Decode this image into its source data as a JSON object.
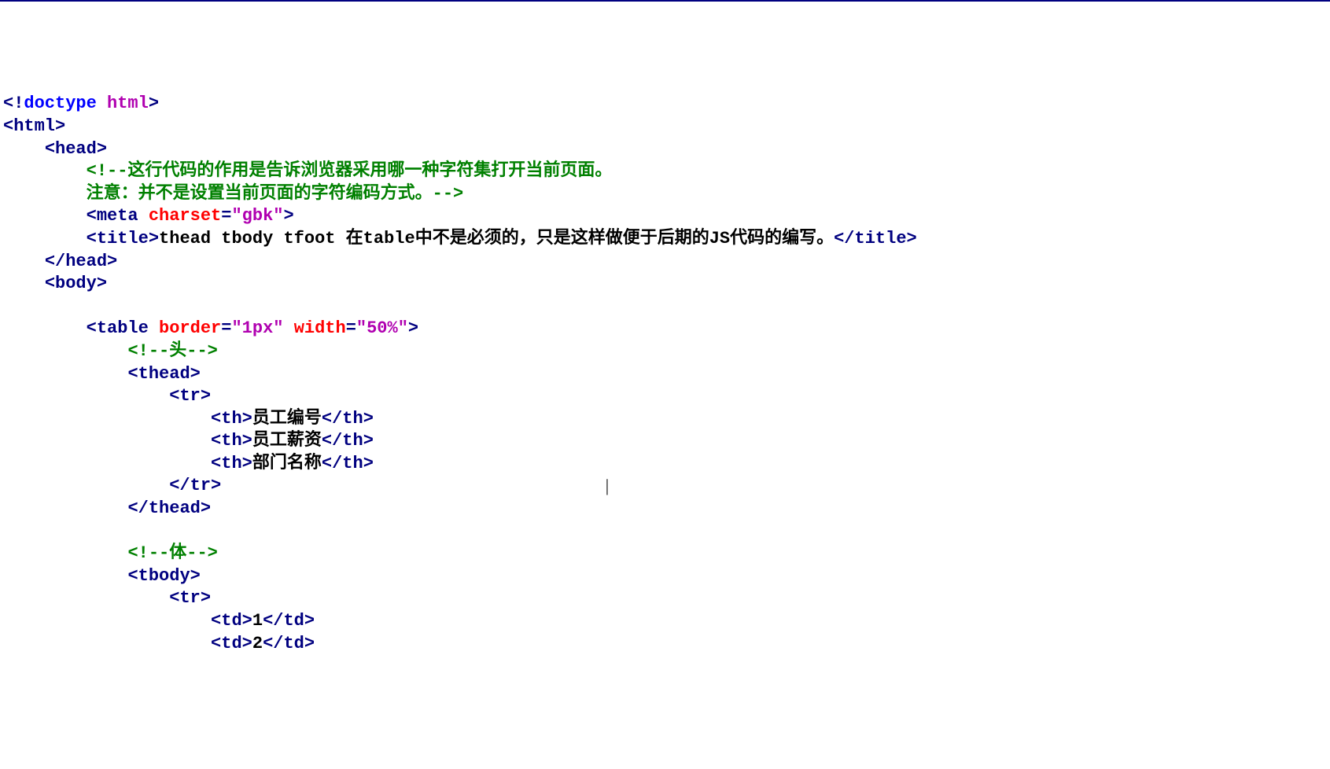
{
  "code": {
    "doctype_open": "<!",
    "doctype_kw": "doctype",
    "doctype_val": "html",
    "doctype_close": ">",
    "lt": "<",
    "lt_close": "</",
    "gt": ">",
    "sp": " ",
    "html_tag": "html",
    "head_tag": "head",
    "body_tag": "body",
    "meta_tag": "meta",
    "title_tag": "title",
    "table_tag": "table",
    "thead_tag": "thead",
    "tbody_tag": "tbody",
    "tr_tag": "tr",
    "th_tag": "th",
    "td_tag": "td",
    "charset_attr": "charset",
    "charset_val": "\"gbk\"",
    "border_attr": "border",
    "border_val": "\"1px\"",
    "width_attr": "width",
    "width_val": "\"50%\"",
    "eq": "=",
    "comment1": "<!--这行代码的作用是告诉浏览器采用哪一种字符集打开当前页面。",
    "comment1b": "注意：并不是设置当前页面的字符编码方式。-->",
    "title_text": "thead tbody tfoot 在table中不是必须的，只是这样做便于后期的JS代码的编写。",
    "comment_head": "<!--头-->",
    "comment_body": "<!--体-->",
    "th1": "员工编号",
    "th2": "员工薪资",
    "th3": "部门名称",
    "td1": "1",
    "td2": "2"
  },
  "indent": {
    "i1": "    ",
    "i2": "        ",
    "i3": "            ",
    "i4": "                ",
    "i5": "                    "
  },
  "cursor_spaces": "                                     "
}
